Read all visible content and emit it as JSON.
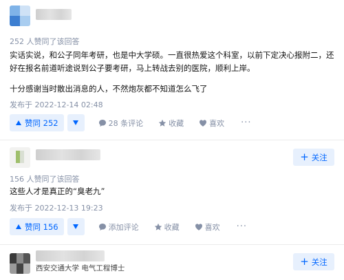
{
  "answers": [
    {
      "vote_info": "252 人赞同了该回答",
      "paragraphs": [
        "实话实说，和公子同年考研，也是中大学硕。一直很热爱这个科室，以前下定决心报附二，还好在报名前道听途说到公子要考研，马上转战去别的医院，顺利上岸。",
        "十分感谢当时散出消息的人，不然炮灰都不知道怎么飞了"
      ],
      "published": "发布于 2022-12-14 02:48",
      "vote_label": "赞同 252",
      "actions": [
        {
          "icon": "comment-icon",
          "label": "28 条评论"
        },
        {
          "icon": "star-icon",
          "label": "收藏"
        },
        {
          "icon": "heart-icon",
          "label": "喜欢"
        }
      ],
      "more": "···"
    },
    {
      "vote_info": "156 人赞同了该回答",
      "paragraphs": [
        "这些人才是真正的“臭老九”"
      ],
      "published": "发布于 2022-12-13 19:23",
      "vote_label": "赞同 156",
      "actions": [
        {
          "icon": "comment-icon",
          "label": "添加评论"
        },
        {
          "icon": "star-icon",
          "label": "收藏"
        },
        {
          "icon": "heart-icon",
          "label": "喜欢"
        }
      ],
      "more": "···",
      "follow_label": "关注"
    },
    {
      "headline": "西安交通大学 电气工程博士",
      "follow_label": "关注"
    }
  ],
  "colors": {
    "accent": "#0066ff",
    "accent_bg": "#e7f0fd",
    "meta": "#8590a6"
  }
}
